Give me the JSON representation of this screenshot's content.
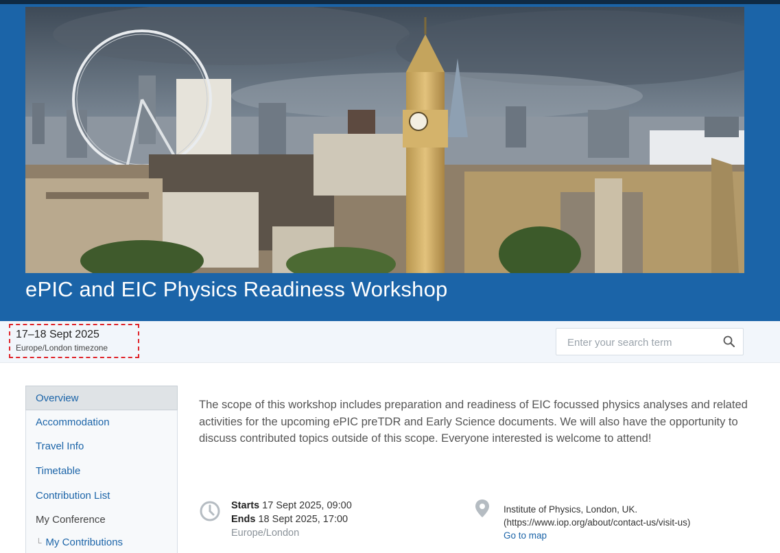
{
  "event": {
    "title": "ePIC and EIC Physics Readiness Workshop",
    "dates": "17–18 Sept 2025",
    "timezone_note": "Europe/London timezone"
  },
  "search": {
    "placeholder": "Enter your search term",
    "icon": "search-icon"
  },
  "sidebar": {
    "items": [
      {
        "label": "Overview",
        "active": true
      },
      {
        "label": "Accommodation"
      },
      {
        "label": "Travel Info"
      },
      {
        "label": "Timetable"
      },
      {
        "label": "Contribution List"
      },
      {
        "label": "My Conference"
      }
    ],
    "subitems": [
      {
        "label": "My Contributions"
      }
    ]
  },
  "description": "The scope of this workshop includes preparation and readiness of EIC focussed physics analyses and related activities for the upcoming ePIC preTDR and Early Science documents. We will also have the opportunity to discuss contributed topics outside of this scope. Everyone interested is welcome to attend!",
  "schedule": {
    "starts_label": "Starts",
    "starts_value": "17 Sept 2025, 09:00",
    "ends_label": "Ends",
    "ends_value": "18 Sept 2025, 17:00",
    "timezone": "Europe/London"
  },
  "location": {
    "name": "Institute of Physics, London, UK.",
    "url": "(https://www.iop.org/about/contact-us/visit-us)",
    "map_link": "Go to map"
  },
  "colors": {
    "header": "#1b64a8",
    "link": "#1b64a8",
    "highlight_border": "#e0242a"
  }
}
